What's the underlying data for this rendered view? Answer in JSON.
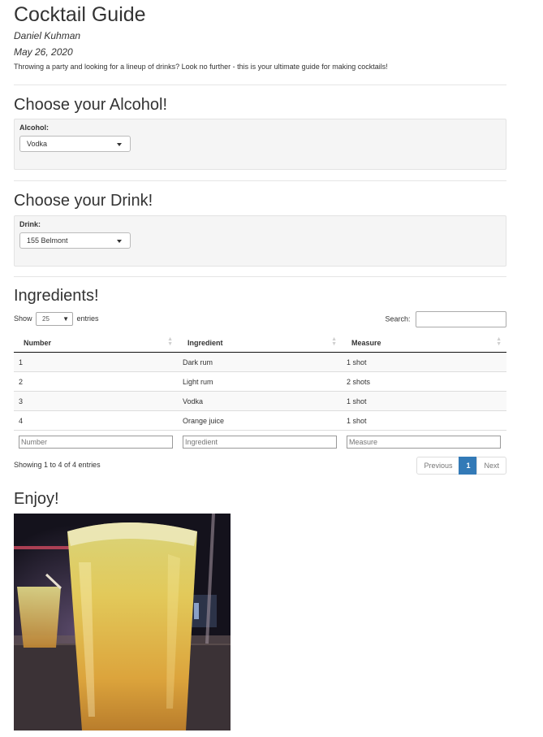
{
  "header": {
    "title": "Cocktail Guide",
    "author": "Daniel Kuhman",
    "date": "May 26, 2020",
    "intro": "Throwing a party and looking for a lineup of drinks? Look no further - this is your ultimate guide for making cocktails!"
  },
  "alcohol": {
    "heading": "Choose your Alcohol!",
    "label": "Alcohol:",
    "selected": "Vodka"
  },
  "drink": {
    "heading": "Choose your Drink!",
    "label": "Drink:",
    "selected": "155 Belmont"
  },
  "ingredients": {
    "heading": "Ingredients!",
    "show_label": "Show",
    "entries_label": "entries",
    "length_value": "25",
    "search_label": "Search:",
    "columns": [
      "Number",
      "Ingredient",
      "Measure"
    ],
    "rows": [
      [
        "1",
        "Dark rum",
        "1 shot"
      ],
      [
        "2",
        "Light rum",
        "2 shots"
      ],
      [
        "3",
        "Vodka",
        "1 shot"
      ],
      [
        "4",
        "Orange juice",
        "1 shot"
      ]
    ],
    "filters": [
      "Number",
      "Ingredient",
      "Measure"
    ],
    "info": "Showing 1 to 4 of 4 entries",
    "pagination": {
      "previous": "Previous",
      "current": "1",
      "next": "Next"
    }
  },
  "enjoy": {
    "heading": "Enjoy!",
    "photo_icon": "cocktail-photo"
  },
  "colors": {
    "accent": "#337ab7",
    "text": "#333333",
    "well": "#f5f5f5"
  }
}
